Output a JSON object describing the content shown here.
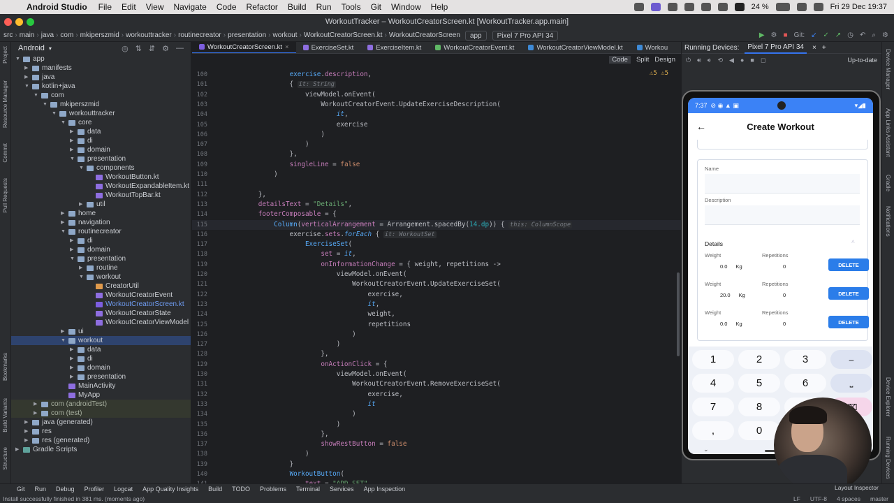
{
  "menubar": {
    "app": "Android Studio",
    "items": [
      "File",
      "Edit",
      "View",
      "Navigate",
      "Code",
      "Refactor",
      "Build",
      "Run",
      "Tools",
      "Git",
      "Window",
      "Help"
    ],
    "battery": "24 %",
    "clock": "Fri 29 Dec  19:37"
  },
  "window_title": "WorkoutTracker – WorkoutCreatorScreen.kt [WorkoutTracker.app.main]",
  "breadcrumb": [
    "src",
    "main",
    "java",
    "com",
    "mkiperszmid",
    "workouttracker",
    "routinecreator",
    "presentation",
    "workout",
    "WorkoutCreatorScreen.kt",
    "WorkoutCreatorScreen"
  ],
  "toolbar": {
    "run_config": "app",
    "device": "Pixel 7 Pro API 34",
    "git": "Git:"
  },
  "project": {
    "header": "Android",
    "rows": [
      {
        "label": "app",
        "d": 0,
        "open": true,
        "kind": "folder"
      },
      {
        "label": "manifests",
        "d": 1,
        "open": false,
        "kind": "folder"
      },
      {
        "label": "java",
        "d": 1,
        "open": false,
        "kind": "folder"
      },
      {
        "label": "kotlin+java",
        "d": 1,
        "open": true,
        "kind": "folder"
      },
      {
        "label": "com",
        "d": 2,
        "open": true,
        "kind": "folder"
      },
      {
        "label": "mkiperszmid",
        "d": 3,
        "open": true,
        "kind": "folder"
      },
      {
        "label": "workouttracker",
        "d": 4,
        "open": true,
        "kind": "folder"
      },
      {
        "label": "core",
        "d": 5,
        "open": true,
        "kind": "folder"
      },
      {
        "label": "data",
        "d": 6,
        "open": false,
        "kind": "folder"
      },
      {
        "label": "di",
        "d": 6,
        "open": false,
        "kind": "folder"
      },
      {
        "label": "domain",
        "d": 6,
        "open": false,
        "kind": "folder"
      },
      {
        "label": "presentation",
        "d": 6,
        "open": true,
        "kind": "folder"
      },
      {
        "label": "components",
        "d": 7,
        "open": true,
        "kind": "folder"
      },
      {
        "label": "WorkoutButton.kt",
        "d": 8,
        "kind": "kt"
      },
      {
        "label": "WorkoutExpandableItem.kt",
        "d": 8,
        "kind": "kt"
      },
      {
        "label": "WorkoutTopBar.kt",
        "d": 8,
        "kind": "kt"
      },
      {
        "label": "util",
        "d": 7,
        "open": false,
        "kind": "folder"
      },
      {
        "label": "home",
        "d": 5,
        "open": false,
        "kind": "folder"
      },
      {
        "label": "navigation",
        "d": 5,
        "open": false,
        "kind": "folder"
      },
      {
        "label": "routinecreator",
        "d": 5,
        "open": true,
        "kind": "folder"
      },
      {
        "label": "di",
        "d": 6,
        "open": false,
        "kind": "folder"
      },
      {
        "label": "domain",
        "d": 6,
        "open": false,
        "kind": "folder"
      },
      {
        "label": "presentation",
        "d": 6,
        "open": true,
        "kind": "folder"
      },
      {
        "label": "routine",
        "d": 7,
        "open": false,
        "kind": "folder"
      },
      {
        "label": "workout",
        "d": 7,
        "open": true,
        "kind": "folder"
      },
      {
        "label": "CreatorUtil",
        "d": 8,
        "kind": "util"
      },
      {
        "label": "WorkoutCreatorEvent",
        "d": 8,
        "kind": "kt"
      },
      {
        "label": "WorkoutCreatorScreen.kt",
        "d": 8,
        "kind": "kt",
        "active": true
      },
      {
        "label": "WorkoutCreatorState",
        "d": 8,
        "kind": "kt"
      },
      {
        "label": "WorkoutCreatorViewModel",
        "d": 8,
        "kind": "kt"
      },
      {
        "label": "ui",
        "d": 5,
        "open": false,
        "kind": "folder"
      },
      {
        "label": "workout",
        "d": 5,
        "open": true,
        "kind": "folder",
        "sel": true
      },
      {
        "label": "data",
        "d": 6,
        "open": false,
        "kind": "folder"
      },
      {
        "label": "di",
        "d": 6,
        "open": false,
        "kind": "folder"
      },
      {
        "label": "domain",
        "d": 6,
        "open": false,
        "kind": "folder"
      },
      {
        "label": "presentation",
        "d": 6,
        "open": false,
        "kind": "folder"
      },
      {
        "label": "MainActivity",
        "d": 5,
        "kind": "kt"
      },
      {
        "label": "MyApp",
        "d": 5,
        "kind": "kt"
      },
      {
        "label": "com (androidTest)",
        "d": 2,
        "open": false,
        "kind": "folder",
        "muted": true
      },
      {
        "label": "com (test)",
        "d": 2,
        "open": false,
        "kind": "folder",
        "muted": true
      },
      {
        "label": "java (generated)",
        "d": 1,
        "open": false,
        "kind": "folder"
      },
      {
        "label": "res",
        "d": 1,
        "open": false,
        "kind": "folder"
      },
      {
        "label": "res (generated)",
        "d": 1,
        "open": false,
        "kind": "folder"
      },
      {
        "label": "Gradle Scripts",
        "d": 0,
        "open": false,
        "kind": "gradle"
      }
    ]
  },
  "editor_tabs": [
    {
      "label": "WorkoutCreatorScreen.kt",
      "active": true
    },
    {
      "label": "ExerciseSet.kt"
    },
    {
      "label": "ExerciseItem.kt"
    },
    {
      "label": "WorkoutCreatorEvent.kt"
    },
    {
      "label": "WorkoutCreatorViewModel.kt"
    },
    {
      "label": "Workou"
    }
  ],
  "editor_modes": [
    "Code",
    "Split",
    "Design"
  ],
  "warnings": "⚠5 ⚠5",
  "code": [
    {
      "n": "100",
      "html": "                <span class=\"fn\">exercise</span>.<span class=\"prop\">description</span>,"
    },
    {
      "n": "101",
      "html": "                { <span class=\"hint\">it: String</span>"
    },
    {
      "n": "102",
      "html": "                    viewModel.onEvent("
    },
    {
      "n": "103",
      "html": "                        WorkoutCreatorEvent.UpdateExerciseDescription("
    },
    {
      "n": "104",
      "html": "                            <span class=\"ital\">it</span>,"
    },
    {
      "n": "105",
      "html": "                            exercise"
    },
    {
      "n": "106",
      "html": "                        )"
    },
    {
      "n": "107",
      "html": "                    )"
    },
    {
      "n": "108",
      "html": "                },"
    },
    {
      "n": "109",
      "html": "                <span class=\"prop\">singleLine</span> = <span class=\"kw\">false</span>"
    },
    {
      "n": "110",
      "html": "            )"
    },
    {
      "n": "111",
      "html": ""
    },
    {
      "n": "112",
      "html": "        },"
    },
    {
      "n": "113",
      "html": "        <span class=\"prop\">detailsText</span> = <span class=\"str\">\"Details\"</span>,"
    },
    {
      "n": "114",
      "html": "        <span class=\"prop\">footerComposable</span> = {"
    },
    {
      "n": "115",
      "html": "            <span class=\"fn\">Column</span>(<span class=\"prop\">verticalArrangement</span> = Arrangement.spacedBy(<span class=\"num\">14.dp</span>)) { <span class=\"hint\">this: ColumnScope</span>",
      "cur": true
    },
    {
      "n": "116",
      "html": "                exercise.<span class=\"prop\">sets</span>.<span class=\"ital\">forEach</span> { <span class=\"hint\">it: WorkoutSet</span>"
    },
    {
      "n": "117",
      "html": "                    <span class=\"fn\">ExerciseSet</span>("
    },
    {
      "n": "118",
      "html": "                        <span class=\"prop\">set</span> = <span class=\"ital\">it</span>,"
    },
    {
      "n": "119",
      "html": "                        <span class=\"prop\">onInformationChange</span> = { weight, repetitions ->"
    },
    {
      "n": "120",
      "html": "                            viewModel.onEvent("
    },
    {
      "n": "121",
      "html": "                                WorkoutCreatorEvent.UpdateExerciseSet("
    },
    {
      "n": "122",
      "html": "                                    exercise,"
    },
    {
      "n": "123",
      "html": "                                    <span class=\"ital\">it</span>,"
    },
    {
      "n": "124",
      "html": "                                    weight,"
    },
    {
      "n": "125",
      "html": "                                    repetitions"
    },
    {
      "n": "126",
      "html": "                                )"
    },
    {
      "n": "127",
      "html": "                            )"
    },
    {
      "n": "128",
      "html": "                        },"
    },
    {
      "n": "129",
      "html": "                        <span class=\"prop\">onActionClick</span> = {"
    },
    {
      "n": "130",
      "html": "                            viewModel.onEvent("
    },
    {
      "n": "131",
      "html": "                                WorkoutCreatorEvent.RemoveExerciseSet("
    },
    {
      "n": "132",
      "html": "                                    exercise,"
    },
    {
      "n": "133",
      "html": "                                    <span class=\"ital\">it</span>"
    },
    {
      "n": "134",
      "html": "                                )"
    },
    {
      "n": "135",
      "html": "                            )"
    },
    {
      "n": "136",
      "html": "                        },"
    },
    {
      "n": "137",
      "html": "                        <span class=\"prop\">showRestButton</span> = <span class=\"kw\">false</span>"
    },
    {
      "n": "138",
      "html": "                    )"
    },
    {
      "n": "139",
      "html": "                }"
    },
    {
      "n": "140",
      "html": "                <span class=\"fn\">WorkoutButton</span>("
    },
    {
      "n": "141",
      "html": "                    <span class=\"prop\">text</span> = <span class=\"str\">\"ADD SET\"</span>,"
    }
  ],
  "running": {
    "title": "Running Devices:",
    "device_tab": "Pixel 7 Pro API 34",
    "up_to_date": "Up-to-date"
  },
  "phone": {
    "time": "7:37",
    "title": "Create Workout",
    "name_label": "Name",
    "description_label": "Description",
    "details": "Details",
    "weight_label": "Weight",
    "reps_label": "Repetitions",
    "kg": "Kg",
    "delete": "DELETE",
    "sets": [
      {
        "weight": "0.0",
        "reps": "0"
      },
      {
        "weight": "20.0",
        "reps": "0"
      },
      {
        "weight": "0.0",
        "reps": "0"
      }
    ],
    "keys": [
      "1",
      "2",
      "3",
      "–",
      "4",
      "5",
      "6",
      "⎵",
      "7",
      "8",
      "9",
      "⌫",
      ",",
      "0"
    ]
  },
  "bottom_tools": [
    "Git",
    "Run",
    "Debug",
    "Profiler",
    "Logcat",
    "App Quality Insights",
    "Build",
    "TODO",
    "Problems",
    "Terminal",
    "Services",
    "App Inspection"
  ],
  "status": {
    "message": "Install successfully finished in 381 ms. (moments ago)",
    "right": [
      "LF",
      "UTF-8",
      "4 spaces",
      "master"
    ],
    "inspector": "Layout Inspector"
  },
  "left_strip": [
    "Project",
    "Resource Manager",
    "Commit",
    "Pull Requests",
    "Bookmarks",
    "Build Variants",
    "Structure"
  ],
  "right_strip": [
    "Device Manager",
    "App Links Assistant",
    "Gradle",
    "Notifications",
    "Device Explorer",
    "Running Devices"
  ]
}
